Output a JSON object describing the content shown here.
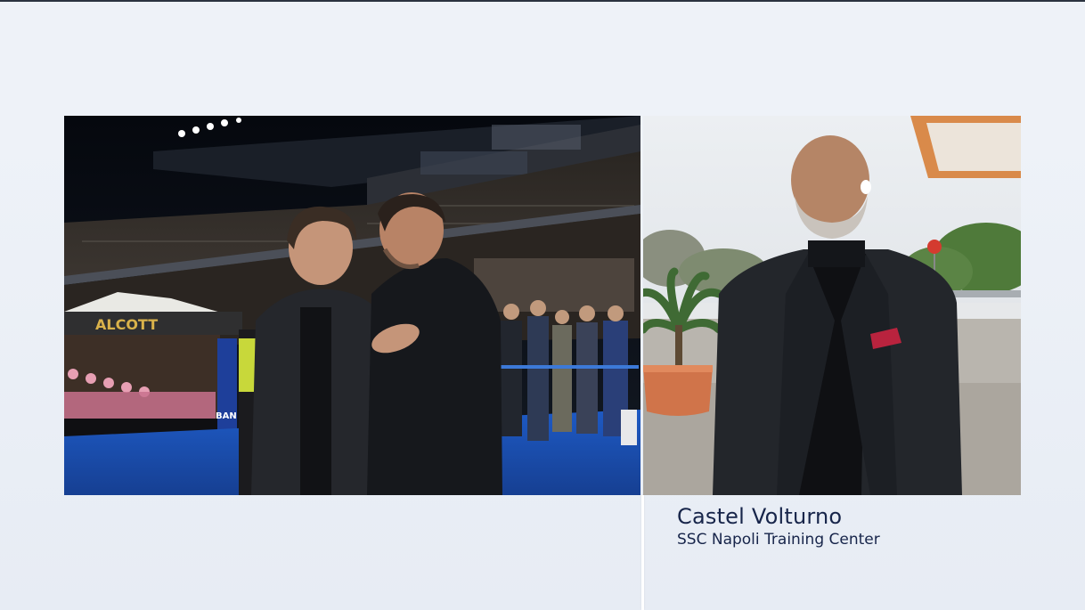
{
  "left_feed": {
    "stadium_banner_text": "ALCOTT",
    "ad_board_text": "BAN"
  },
  "right_feed": {
    "caption": {
      "location": "Castel Volturno",
      "subtitle": "SSC Napoli Training Center"
    }
  },
  "colors": {
    "background": "#eef2f8",
    "caption_text": "#17254a",
    "pitch_blue": "#1d4fb0"
  }
}
